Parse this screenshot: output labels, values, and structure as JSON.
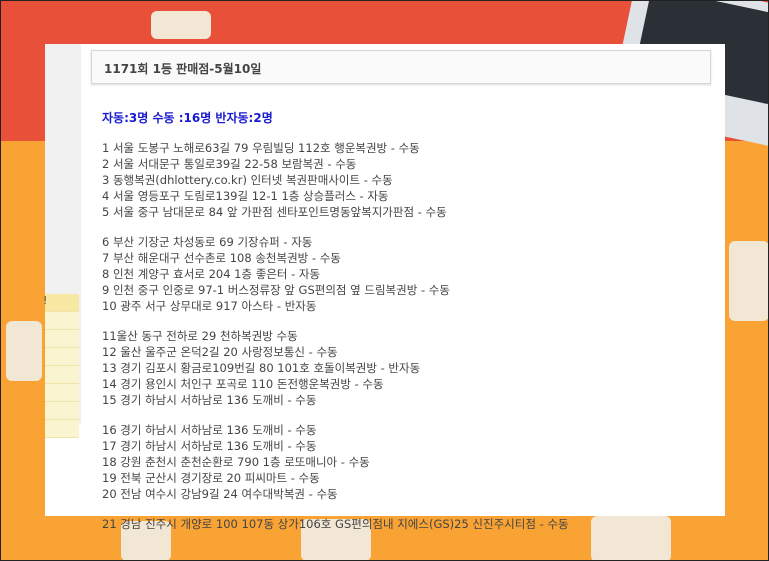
{
  "post": {
    "title": "1171회 1등 판매점-5월10일",
    "summary": "자동:3명 수동 :16명 반자동:2명",
    "side_label": "!"
  },
  "groups": [
    [
      "1 서울 도봉구 노해로63길 79 우림빌딩 112호 행운복권방 - 수동",
      "2 서울 서대문구 통일로39길 22-58 보람복권 - 수동",
      "3 동행복권(dhlottery.co.kr) 인터넷 복권판매사이트 - 수동",
      "4 서울 영등포구 도림로139길 12-1 1층 상승플러스 - 자동",
      "5 서울 중구 남대문로 84 앞 가판점 센타포인트명동앞복지가판점 - 수동"
    ],
    [
      "6 부산 기장군 차성동로 69 기장슈퍼 - 자동",
      "7 부산 해운대구 선수촌로 108 송천복권방 - 수동",
      "8 인천 계양구 효서로 204 1층 좋은터 - 자동",
      "9 인천 중구 인중로 97-1 버스정류장 앞 GS편의점 옆 드림복권방 - 수동",
      "10 광주 서구 상무대로 917 아스타 - 반자동"
    ],
    [
      "11울산 동구 전하로 29 천하복권방 수동",
      "12 울산 울주군 온덕2길 20 사랑정보통신 - 수동",
      "13 경기 김포시 황금로109번길 80 101호 호돌이복권방 - 반자동",
      "14 경기 용인시 처인구 포곡로 110 돈전행운복권방 - 수동",
      "15 경기 하남시 서하남로 136 도깨비 - 수동"
    ],
    [
      "16 경기 하남시 서하남로 136 도깨비 - 수동",
      "17 경기 하남시 서하남로 136 도깨비 - 수동",
      "18 강원 춘천시 춘천순환로 790 1층 로또매니아 - 수동",
      "19 전북 군산시 경기장로 20 피씨마트 - 수동",
      "20 전남 여수시 강남9길 24 여수대박복권 - 수동"
    ],
    [
      "21 경남 진주시 개양로 100 107동 상가106호 GS편의점내 지에스(GS)25 신진주시티점 - 수동"
    ]
  ]
}
